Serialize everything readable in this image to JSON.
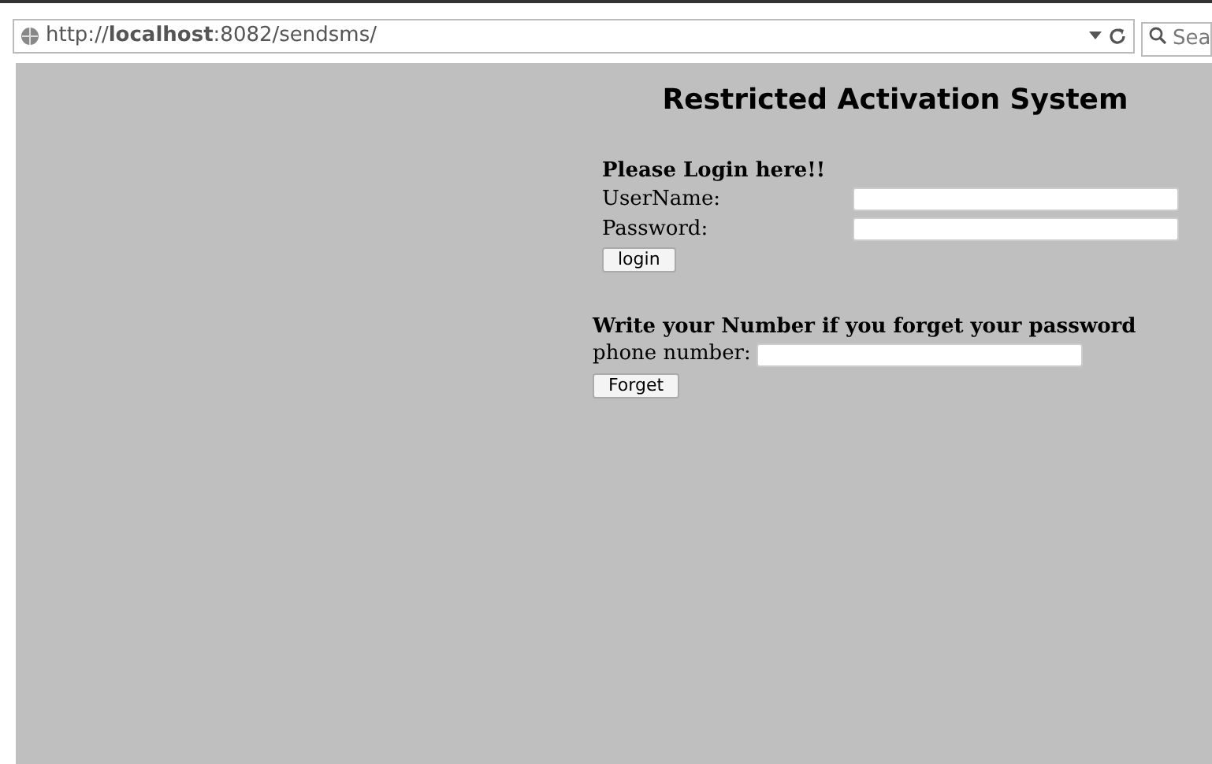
{
  "address_bar": {
    "url": "http://**localhost**:8082/sendsms/"
  },
  "search": {
    "placeholder": "Sea"
  },
  "title": "Restricted Activation System",
  "login": {
    "heading": "Please Login here!!",
    "username_label": "UserName:",
    "password_label": "Password:",
    "button": "login"
  },
  "forgot": {
    "heading": "Write your Number if you forget your password",
    "phone_label": "phone number:",
    "button": "Forget"
  }
}
